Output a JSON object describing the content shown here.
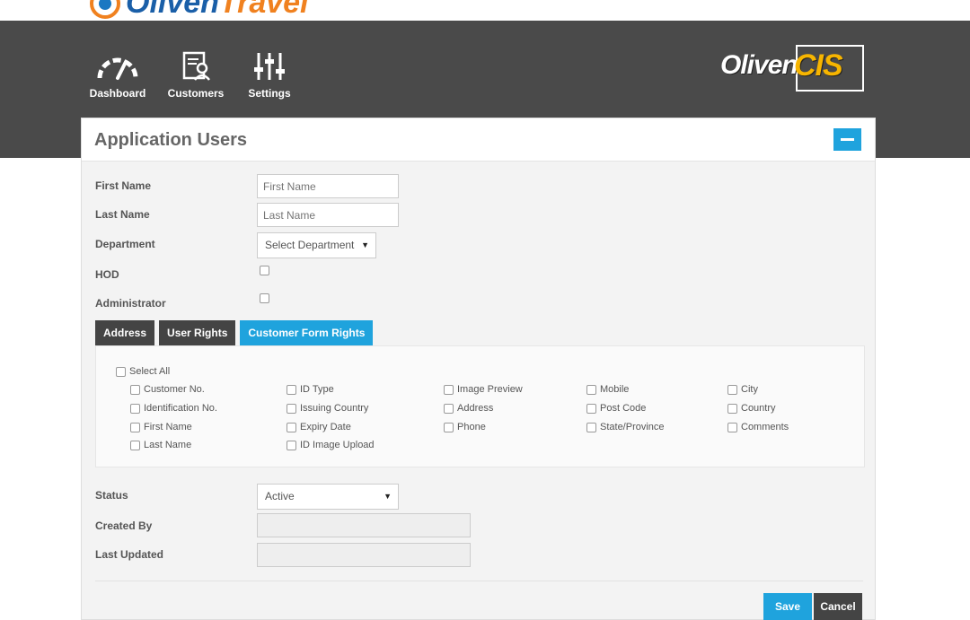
{
  "top_logo": {
    "part1": "Oliven",
    "part2": "Travel"
  },
  "nav": [
    {
      "label": "Dashboard",
      "icon": "gauge-icon"
    },
    {
      "label": "Customers",
      "icon": "user-doc-icon"
    },
    {
      "label": "Settings",
      "icon": "sliders-icon"
    }
  ],
  "brand": {
    "part1": "Oliven",
    "part2": "CIS"
  },
  "panel": {
    "title": "Application Users"
  },
  "form": {
    "first_name_label": "First Name",
    "first_name_placeholder": "First Name",
    "last_name_label": "Last Name",
    "last_name_placeholder": "Last Name",
    "department_label": "Department",
    "department_value": "Select Department",
    "hod_label": "HOD",
    "admin_label": "Administrator",
    "status_label": "Status",
    "status_value": "Active",
    "created_by_label": "Created By",
    "last_updated_label": "Last Updated"
  },
  "tabs": [
    "Address",
    "User Rights",
    "Customer Form Rights"
  ],
  "rights": {
    "select_all": "Select All",
    "columns": [
      [
        "Customer No.",
        "Identification No.",
        "First Name",
        "Last Name"
      ],
      [
        "ID Type",
        "Issuing Country",
        "Expiry Date",
        "ID Image Upload"
      ],
      [
        "Image Preview",
        "Address",
        "Phone"
      ],
      [
        "Mobile",
        "Post Code",
        "State/Province"
      ],
      [
        "City",
        "Country",
        "Comments"
      ]
    ]
  },
  "buttons": {
    "save": "Save",
    "cancel": "Cancel"
  },
  "colors": {
    "accent": "#1fa3dd",
    "header": "#4a4a4a",
    "dark_tab": "#444444",
    "brand_orange": "#f7b500"
  }
}
